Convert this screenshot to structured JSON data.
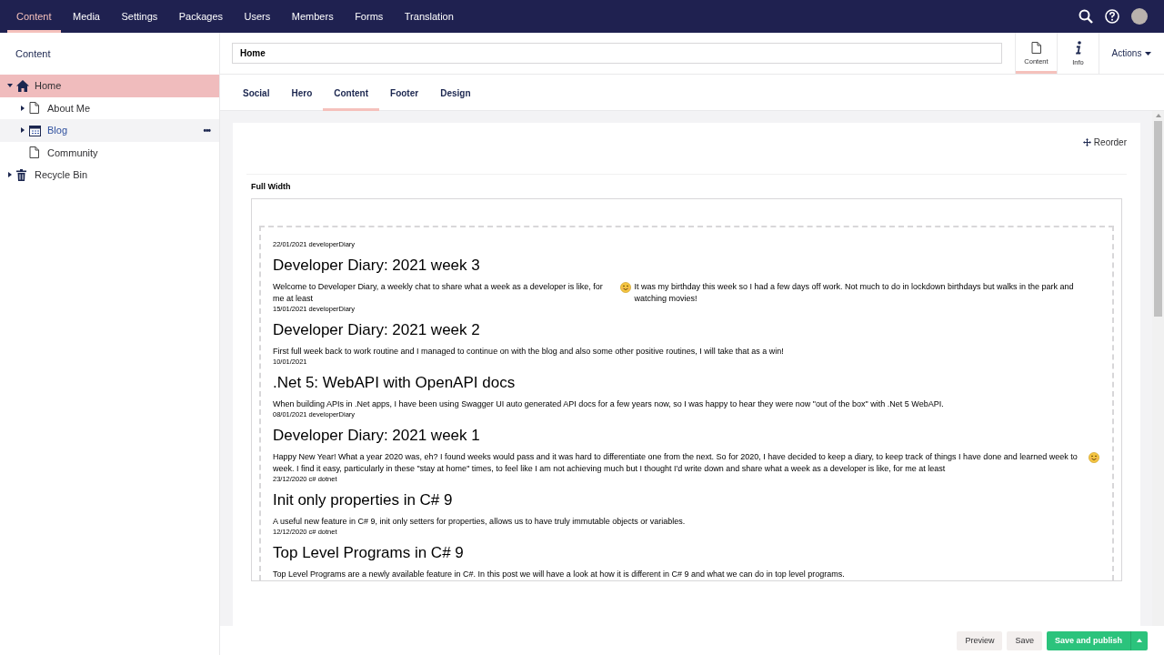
{
  "top_nav": [
    {
      "label": "Content",
      "selected": true
    },
    {
      "label": "Media",
      "selected": false
    },
    {
      "label": "Settings",
      "selected": false
    },
    {
      "label": "Packages",
      "selected": false
    },
    {
      "label": "Users",
      "selected": false
    },
    {
      "label": "Members",
      "selected": false
    },
    {
      "label": "Forms",
      "selected": false
    },
    {
      "label": "Translation",
      "selected": false
    }
  ],
  "sidebar": {
    "title": "Content",
    "tree": [
      {
        "label": "Home",
        "kind": "home",
        "expanded": true,
        "selected": true,
        "hover": false,
        "children": [
          {
            "label": "About Me",
            "kind": "page",
            "expanded": false,
            "selected": false,
            "hover": false
          },
          {
            "label": "Blog",
            "kind": "calendar",
            "expanded": false,
            "selected": false,
            "hover": true,
            "more": "•••"
          },
          {
            "label": "Community",
            "kind": "page",
            "selected": false,
            "hover": false
          }
        ]
      },
      {
        "label": "Recycle Bin",
        "kind": "trash",
        "expanded": false,
        "selected": false,
        "hover": false
      }
    ]
  },
  "editor": {
    "name": "Home",
    "apps": [
      {
        "label": "Content",
        "kind": "page",
        "selected": true
      },
      {
        "label": "Info",
        "kind": "info",
        "selected": false
      }
    ],
    "actions": "Actions",
    "tabs": [
      {
        "label": "Social",
        "selected": false
      },
      {
        "label": "Hero",
        "selected": false
      },
      {
        "label": "Content",
        "selected": true
      },
      {
        "label": "Footer",
        "selected": false
      },
      {
        "label": "Design",
        "selected": false
      }
    ],
    "reorder": "Reorder",
    "section_title": "Full Width",
    "posts": [
      {
        "meta": "22/01/2021 developerDiary",
        "title": "Developer Diary: 2021 week 3",
        "excerpt": [
          {
            "kind": "text",
            "text": "Welcome to Developer Diary, a weekly chat to share what a week as a developer is like, for me at least"
          },
          {
            "kind": "emoji"
          },
          {
            "kind": "text",
            "text": "It was my birthday this week so I had a few days off work. Not much to do in lockdown birthdays but walks in the park and watching movies!"
          }
        ]
      },
      {
        "meta": "15/01/2021 developerDiary",
        "title": "Developer Diary: 2021 week 2",
        "excerpt": [
          {
            "kind": "text",
            "text": "First full week back to work routine and I managed to continue on with the blog and also some other positive routines, I will take that as a win!"
          }
        ]
      },
      {
        "meta": "10/01/2021",
        "title": ".Net 5: WebAPI with OpenAPI docs",
        "excerpt": [
          {
            "kind": "text",
            "text": "When building APIs in .Net apps, I have been using Swagger UI auto generated API docs for a few years now, so I was happy to hear they were now \"out of the box\" with .Net 5 WebAPI."
          }
        ]
      },
      {
        "meta": "08/01/2021 developerDiary",
        "title": "Developer Diary: 2021 week 1",
        "excerpt": [
          {
            "kind": "text",
            "text": "Happy New Year! What a year 2020 was, eh? I found weeks would pass and it was hard to differentiate one from the next. So for 2020, I have decided to keep a diary, to keep track of things I have done and learned week to week. I find it easy, particularly in these \"stay at home\" times, to feel like I am not achieving much but I thought I'd write down and share what a week as a developer is like, for me at least"
          },
          {
            "kind": "emoji"
          }
        ]
      },
      {
        "meta": "23/12/2020 c# dotnet",
        "title": "Init only properties in C# 9",
        "excerpt": [
          {
            "kind": "text",
            "text": "A useful new feature in C# 9, init only setters for properties, allows us to have truly immutable objects or variables."
          }
        ]
      },
      {
        "meta": "12/12/2020 c# dotnet",
        "title": "Top Level Programs in C# 9",
        "excerpt": [
          {
            "kind": "text",
            "text": "Top Level Programs are a newly available feature in C#. In this post we will have a look at how it is different in C# 9 and what we can do in top level programs."
          }
        ]
      }
    ]
  },
  "footer_buttons": [
    {
      "label": "Preview",
      "kind": "plain"
    },
    {
      "label": "Save",
      "kind": "plain"
    },
    {
      "label": "Save and publish",
      "kind": "primary"
    }
  ]
}
